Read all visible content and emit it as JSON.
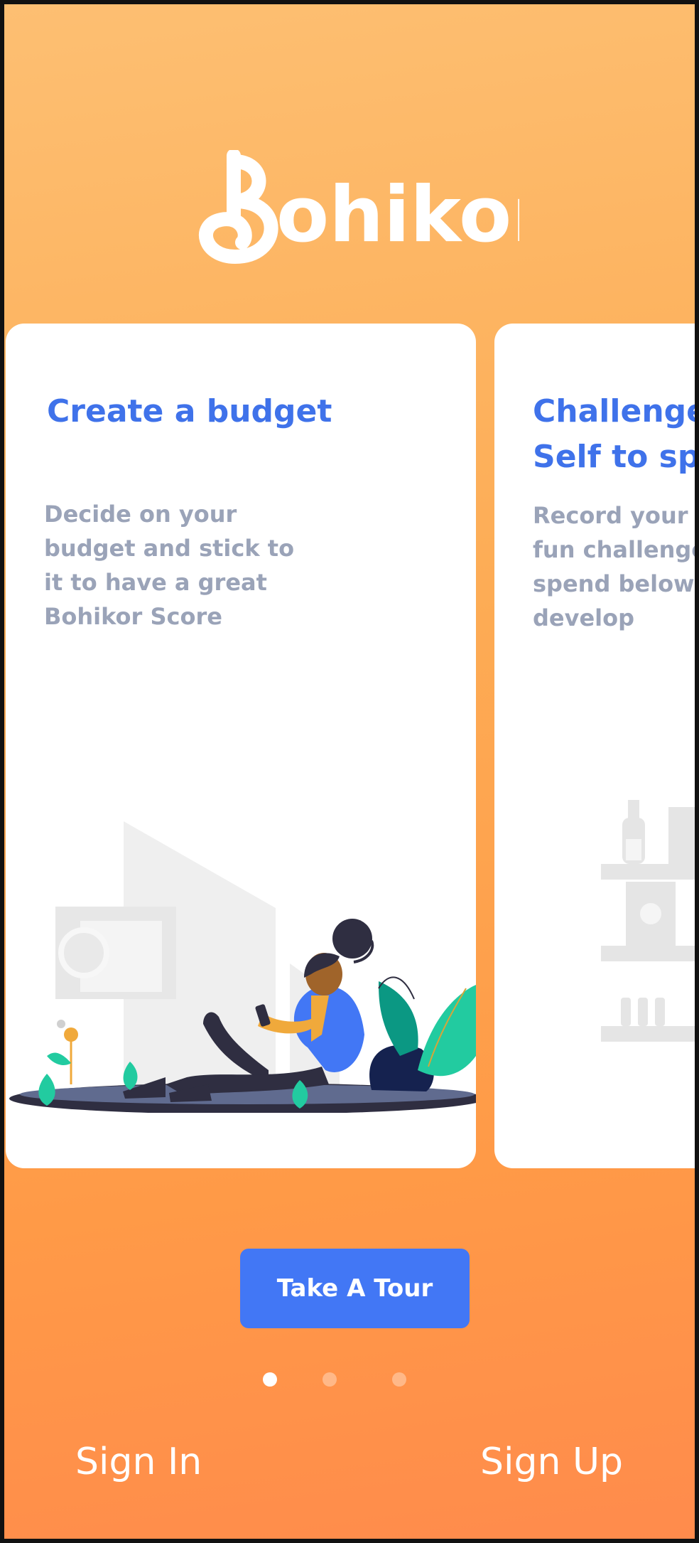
{
  "brand": {
    "name": "Bohikor"
  },
  "cards": [
    {
      "title": "Create a budget",
      "description": "Decide on your budget  and stick to it to have a great Bohikor Score"
    },
    {
      "title_line1": "Challenge y",
      "title_line2": "Self to spe",
      "desc_lines": [
        "Record your da",
        "fun challenges",
        "spend below y",
        "develop"
      ]
    }
  ],
  "actions": {
    "tour_label": "Take A Tour",
    "signin_label": "Sign In",
    "signup_label": "Sign Up"
  },
  "pagination": {
    "count": 3,
    "active": 1
  },
  "colors": {
    "accent": "#4277f5",
    "title": "#3f72ea",
    "muted": "#9aa3b8",
    "bg_top": "#fdbf72",
    "bg_bottom": "#ff8b4c"
  }
}
